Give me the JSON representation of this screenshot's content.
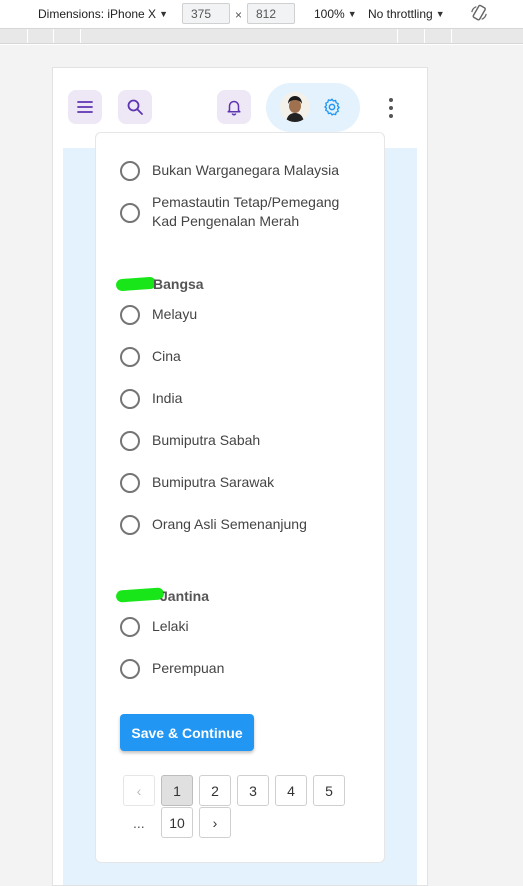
{
  "devtools": {
    "device_label": "Dimensions: iPhone X",
    "width": "375",
    "height": "812",
    "times": "×",
    "zoom": "100%",
    "throttling": "No throttling"
  },
  "appbar": {
    "menu_icon": "hamburger-icon",
    "search_icon": "search-icon",
    "bell_icon": "bell-icon",
    "settings_icon": "gear-icon",
    "more_icon": "more-vertical-icon"
  },
  "citizenship": {
    "options": [
      {
        "label": "Bukan Warganegara Malaysia"
      },
      {
        "label": "Pemastautin Tetap/Pemegang Kad Pengenalan Merah"
      }
    ]
  },
  "race": {
    "label": "Bangsa",
    "options": [
      {
        "label": "Melayu"
      },
      {
        "label": "Cina"
      },
      {
        "label": "India"
      },
      {
        "label": "Bumiputra Sabah"
      },
      {
        "label": "Bumiputra Sarawak"
      },
      {
        "label": "Orang Asli Semenanjung"
      }
    ]
  },
  "gender": {
    "label": "Jantina",
    "options": [
      {
        "label": "Lelaki"
      },
      {
        "label": "Perempuan"
      }
    ]
  },
  "actions": {
    "save_label": "Save & Continue"
  },
  "pagination": {
    "prev": "‹",
    "next": "›",
    "pages": [
      "1",
      "2",
      "3",
      "4",
      "5"
    ],
    "ellipsis": "...",
    "last": "10",
    "active": "1"
  },
  "colors": {
    "accent": "#2196f3",
    "icon_bg": "#ede7f6",
    "icon_purple": "#5e35b1",
    "page_bg": "#e3f2fd",
    "redaction": "#19e619"
  }
}
